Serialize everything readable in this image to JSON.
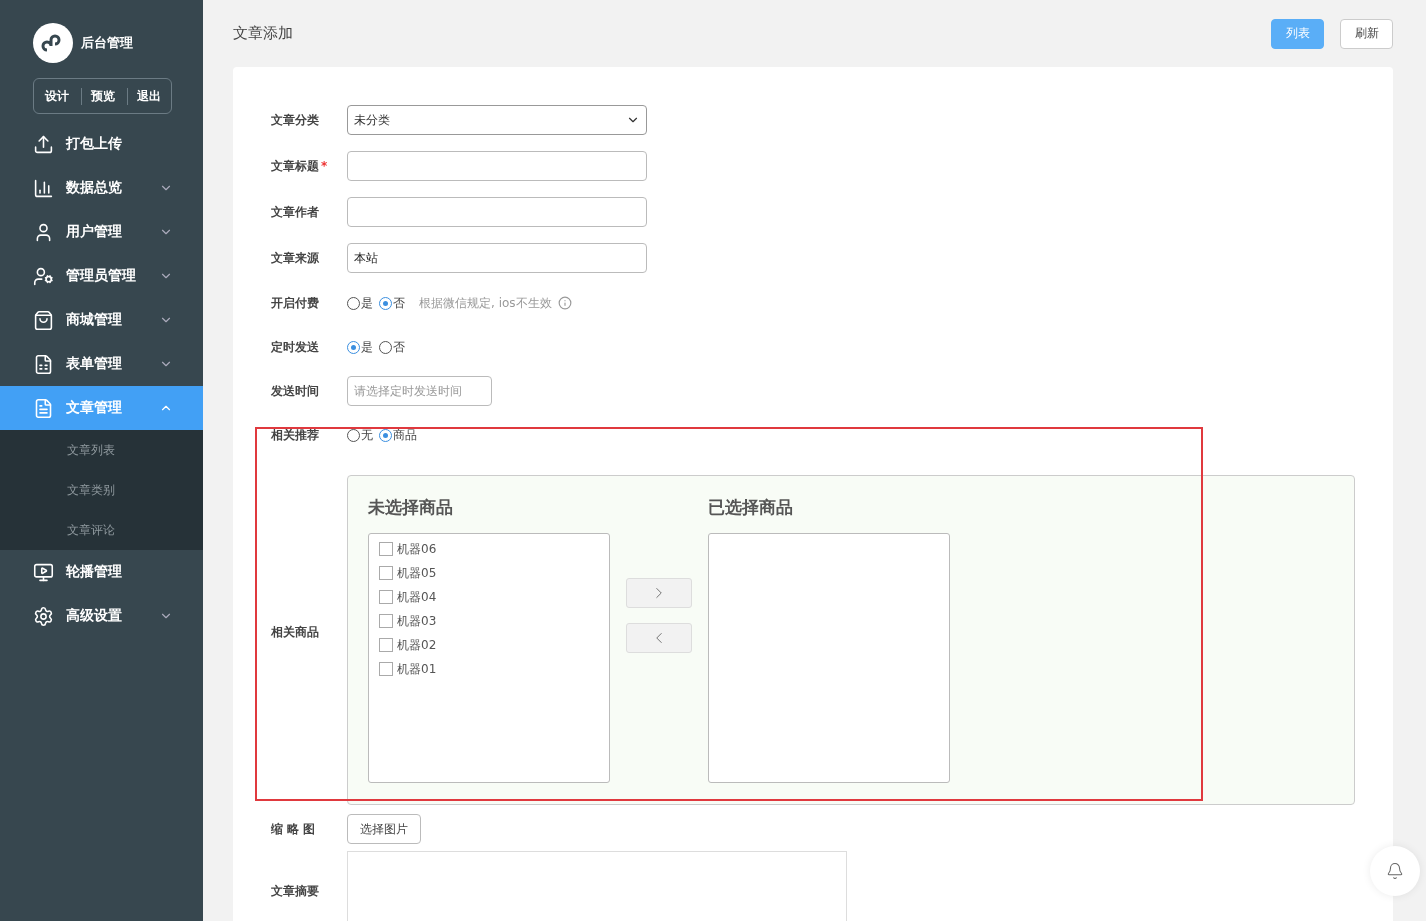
{
  "sidebar": {
    "logo_text": "后台管理",
    "actions": [
      "设计",
      "预览",
      "退出"
    ],
    "menu": [
      {
        "label": "打包上传",
        "kind": "link",
        "selected": false
      },
      {
        "label": "数据总览",
        "kind": "group",
        "expanded": false,
        "selected": false
      },
      {
        "label": "用户管理",
        "kind": "group",
        "expanded": false,
        "selected": false
      },
      {
        "label": "管理员管理",
        "kind": "group",
        "expanded": false,
        "selected": false
      },
      {
        "label": "商城管理",
        "kind": "group",
        "expanded": false,
        "selected": false
      },
      {
        "label": "表单管理",
        "kind": "group",
        "expanded": false,
        "selected": false
      },
      {
        "label": "文章管理",
        "kind": "group",
        "expanded": true,
        "selected": true,
        "children": [
          {
            "label": "文章列表",
            "selected": false
          },
          {
            "label": "文章类别",
            "selected": false
          },
          {
            "label": "文章评论",
            "selected": false
          }
        ]
      },
      {
        "label": "轮播管理",
        "kind": "link",
        "selected": false
      },
      {
        "label": "高级设置",
        "kind": "group",
        "expanded": false,
        "selected": false
      }
    ]
  },
  "header": {
    "title": "文章添加",
    "buttons": [
      {
        "label": "列表",
        "kind": "primary"
      },
      {
        "label": "刷新",
        "kind": "default"
      }
    ]
  },
  "form": {
    "fields": [
      {
        "kind": "select",
        "label": "文章分类",
        "value": "未分类"
      },
      {
        "kind": "text",
        "label": "文章标题",
        "required_mark": "*"
      },
      {
        "kind": "text",
        "label": "文章作者"
      },
      {
        "kind": "text",
        "label": "文章来源",
        "value": "本站"
      },
      {
        "kind": "radio",
        "label": "开启付费",
        "options": [
          {
            "label": "是",
            "selected": false
          },
          {
            "label": "否",
            "selected": true
          }
        ],
        "hint": "根据微信规定, ios不生效"
      },
      {
        "kind": "radio",
        "label": "定时发送",
        "options": [
          {
            "label": "是",
            "selected": true
          },
          {
            "label": "否",
            "selected": false
          }
        ]
      },
      {
        "kind": "time",
        "label": "发送时间",
        "placeholder": "请选择定时发送时间"
      },
      {
        "kind": "radio",
        "label": "相关推荐",
        "options": [
          {
            "label": "无",
            "selected": false
          },
          {
            "label": "商品",
            "selected": true
          }
        ]
      },
      {
        "kind": "transfer",
        "label": "相关商品",
        "left_title": "未选择商品",
        "right_title": "已选择商品",
        "left_items": [
          {
            "label": "机器06",
            "checked": false
          },
          {
            "label": "机器05",
            "checked": false
          },
          {
            "label": "机器04",
            "checked": false
          },
          {
            "label": "机器03",
            "checked": false
          },
          {
            "label": "机器02",
            "checked": false
          },
          {
            "label": "机器01",
            "checked": false
          }
        ]
      },
      {
        "kind": "image",
        "label": "缩 略 图",
        "button": "选择图片"
      },
      {
        "kind": "textarea",
        "label": "文章摘要"
      }
    ]
  }
}
